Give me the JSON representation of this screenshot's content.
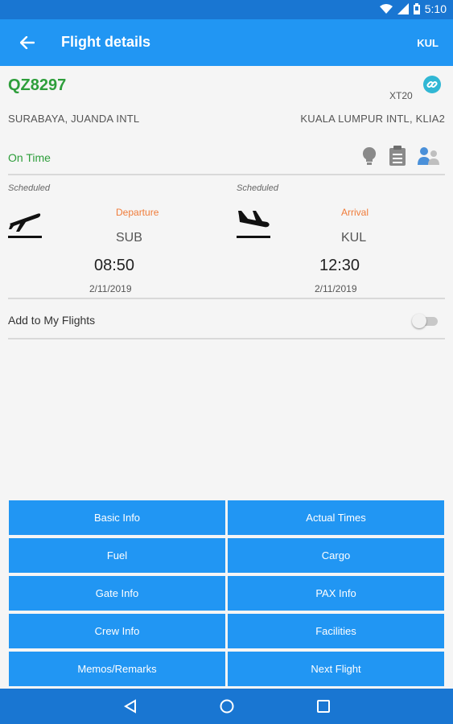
{
  "status_bar": {
    "time": "5:10",
    "icons": [
      "wifi-icon",
      "signal-icon",
      "battery-icon"
    ]
  },
  "app_bar": {
    "title": "Flight details",
    "action": "KUL"
  },
  "flight": {
    "number": "QZ8297",
    "aircraft": "XT20",
    "origin": "SURABAYA, JUANDA INTL",
    "destination": "KUALA LUMPUR INTL, KLIA2",
    "status": "On Time"
  },
  "departure": {
    "label": "Scheduled",
    "direction": "Departure",
    "code": "SUB",
    "time": "08:50",
    "date": "2/11/2019"
  },
  "arrival": {
    "label": "Scheduled",
    "direction": "Arrival",
    "code": "KUL",
    "time": "12:30",
    "date": "2/11/2019"
  },
  "my_flights": {
    "label": "Add to My Flights",
    "enabled": false
  },
  "buttons": {
    "basic_info": "Basic Info",
    "actual_times": "Actual Times",
    "fuel": "Fuel",
    "cargo": "Cargo",
    "gate_info": "Gate Info",
    "pax_info": "PAX Info",
    "crew_info": "Crew Info",
    "facilities": "Facilities",
    "memos": "Memos/Remarks",
    "next_flight": "Next Flight"
  },
  "colors": {
    "primary": "#2196f3",
    "primary_dark": "#1976d2",
    "status_green": "#2e9e3b",
    "accent_orange": "#f07c3a",
    "link_teal": "#31b7d4"
  }
}
